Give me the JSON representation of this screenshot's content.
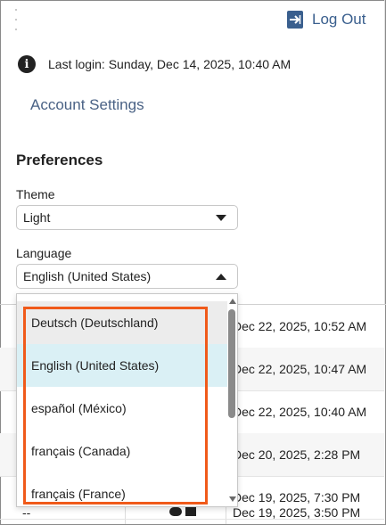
{
  "header": {
    "logout_label": "Log Out",
    "last_login": "Last login: Sunday, Dec 14, 2025, 10:40 AM",
    "account_settings": "Account Settings"
  },
  "preferences": {
    "title": "Preferences",
    "theme": {
      "label": "Theme",
      "value": "Light"
    },
    "language": {
      "label": "Language",
      "value": "English (United States)",
      "expanded": true,
      "options": [
        "Deutsch (Deutschland)",
        "English (United States)",
        "español (México)",
        "français (Canada)",
        "français (France)"
      ]
    }
  },
  "table": {
    "rows": [
      {
        "date": "Dec 22, 2025, 10:52 AM"
      },
      {
        "date": "Dec 22, 2025, 10:47 AM"
      },
      {
        "date": "Dec 22, 2025, 10:40 AM"
      },
      {
        "date": "Dec 20, 2025, 2:28 PM"
      },
      {
        "date": "Dec 19, 2025, 7:30 PM"
      }
    ],
    "last_row": {
      "first": "--",
      "date": "Dec 19, 2025, 3:50 PM"
    }
  },
  "colors": {
    "accent": "#3a5f8e",
    "highlight_outline": "#f05a1a",
    "selected_option": "#daf0f5"
  },
  "icons": [
    "logout-icon",
    "info-icon",
    "chevron-down-icon",
    "chevron-up-icon"
  ]
}
